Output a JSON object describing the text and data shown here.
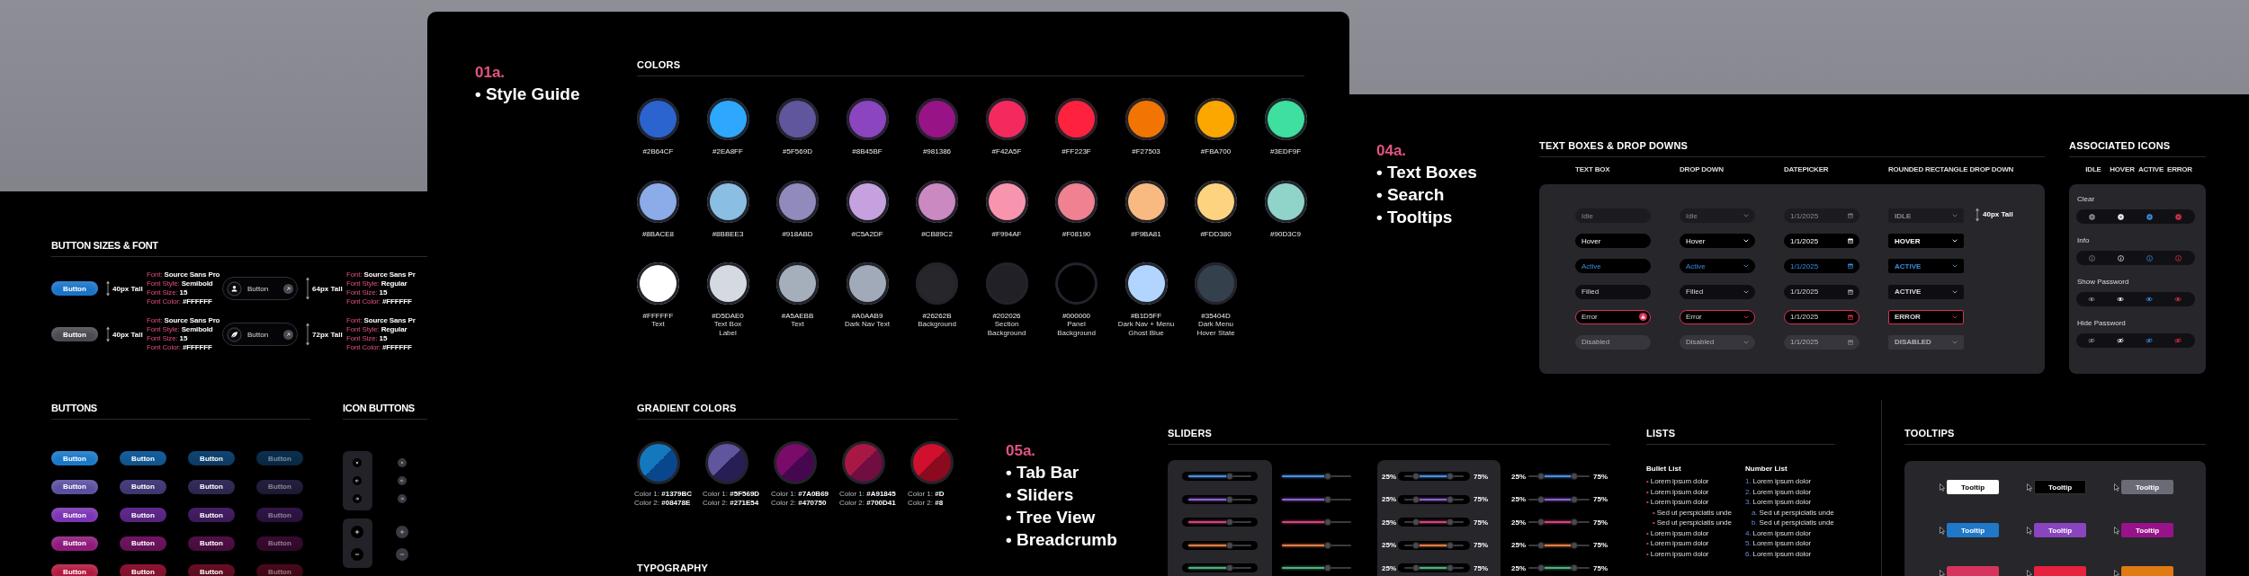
{
  "button_board": {
    "sizes": {
      "title": "BUTTON SIZES & FONT",
      "specs": [
        {
          "kind": "pill",
          "label": "Button",
          "color": "#1a74c8",
          "height": "40px Tall",
          "font": [
            {
              "key": "Font:",
              "value": "Source Sans Pro"
            },
            {
              "key": "Font Style:",
              "value": "Semibold"
            },
            {
              "key": "Font Size:",
              "value": "15"
            },
            {
              "key": "Font Color:",
              "value": "#FFFFFF"
            }
          ]
        },
        {
          "kind": "icon-pill",
          "label": "Button",
          "height": "64px Tall",
          "font": [
            {
              "key": "Font:",
              "value": "Source Sans Pr"
            },
            {
              "key": "Font Style:",
              "value": "Regular"
            },
            {
              "key": "Font Size:",
              "value": "15"
            },
            {
              "key": "Font Color:",
              "value": "#FFFFFF"
            }
          ]
        },
        {
          "kind": "pill",
          "label": "Button",
          "color": "#4a4a50",
          "height": "40px Tall",
          "font": [
            {
              "key": "Font:",
              "value": "Source Sans Pro"
            },
            {
              "key": "Font Style:",
              "value": "Semibold"
            },
            {
              "key": "Font Size:",
              "value": "15"
            },
            {
              "key": "Font Color:",
              "value": "#FFFFFF"
            }
          ]
        },
        {
          "kind": "icon-pill",
          "label": "Button",
          "height": "72px Tall",
          "font": [
            {
              "key": "Font:",
              "value": "Source Sans Pr"
            },
            {
              "key": "Font Style:",
              "value": "Regular"
            },
            {
              "key": "Font Size:",
              "value": "15"
            },
            {
              "key": "Font Color:",
              "value": "#FFFFFF"
            }
          ]
        }
      ]
    },
    "buttons": {
      "title": "BUTTONS",
      "rows": [
        {
          "color": "#1a78c8",
          "buttons": [
            {
              "label": "Button",
              "kind": "normal"
            },
            {
              "label": "Button",
              "kind": "hover"
            },
            {
              "label": "Button",
              "kind": "pressed"
            },
            {
              "label": "Button",
              "kind": "disabled"
            }
          ]
        },
        {
          "color": "#5a4fa0",
          "buttons": [
            {
              "label": "Button",
              "kind": "normal"
            },
            {
              "label": "Button",
              "kind": "hover"
            },
            {
              "label": "Button",
              "kind": "pressed"
            },
            {
              "label": "Button",
              "kind": "disabled"
            }
          ]
        },
        {
          "color": "#7b34b4",
          "buttons": [
            {
              "label": "Button",
              "kind": "normal"
            },
            {
              "label": "Button",
              "kind": "hover"
            },
            {
              "label": "Button",
              "kind": "pressed"
            },
            {
              "label": "Button",
              "kind": "disabled"
            }
          ]
        },
        {
          "color": "#8e1a7c",
          "buttons": [
            {
              "label": "Button",
              "kind": "normal"
            },
            {
              "label": "Button",
              "kind": "hover"
            },
            {
              "label": "Button",
              "kind": "pressed"
            },
            {
              "label": "Button",
              "kind": "disabled"
            }
          ]
        },
        {
          "color": "#b3183f",
          "buttons": [
            {
              "label": "Button",
              "kind": "normal"
            },
            {
              "label": "Button",
              "kind": "hover"
            },
            {
              "label": "Button",
              "kind": "pressed"
            },
            {
              "label": "Button",
              "kind": "disabled"
            }
          ]
        }
      ]
    },
    "icon_buttons": {
      "title": "ICON BUTTONS"
    }
  },
  "style_board": {
    "number": "01a.",
    "topics": [
      "• Style Guide"
    ],
    "colors": {
      "title": "COLORS",
      "swatches": [
        {
          "hex": "#2B64CF",
          "color": "#2b64cf"
        },
        {
          "hex": "#2EA8FF",
          "color": "#2ea8ff"
        },
        {
          "hex": "#5F569D",
          "color": "#5f569d"
        },
        {
          "hex": "#8B45BF",
          "color": "#8b45bf"
        },
        {
          "hex": "#981386",
          "color": "#981386"
        },
        {
          "hex": "#F42A5F",
          "color": "#f42a5f"
        },
        {
          "hex": "#FF223F",
          "color": "#ff223f"
        },
        {
          "hex": "#F27503",
          "color": "#f27503"
        },
        {
          "hex": "#FBA700",
          "color": "#fba700"
        },
        {
          "hex": "#3EDF9F",
          "color": "#3edf9f"
        },
        {
          "hex": "#8BACE8",
          "color": "#8bace8"
        },
        {
          "hex": "#8BBEE3",
          "color": "#8bbee3"
        },
        {
          "hex": "#918ABD",
          "color": "#918abd"
        },
        {
          "hex": "#C5A2DF",
          "color": "#c5a2df"
        },
        {
          "hex": "#CB89C2",
          "color": "#cb89c2"
        },
        {
          "hex": "#F994AF",
          "color": "#f994af"
        },
        {
          "hex": "#F08190",
          "color": "#f08190"
        },
        {
          "hex": "#F9BA81",
          "color": "#f9ba81"
        },
        {
          "hex": "#FDD380",
          "color": "#fdd380"
        },
        {
          "hex": "#90D3C9",
          "color": "#90d3c9"
        },
        {
          "hex": "#FFFFFF",
          "color": "#ffffff",
          "name": "Text"
        },
        {
          "hex": "#D5DAE0",
          "color": "#d5dae0",
          "name": "Text Box\nLabel"
        },
        {
          "hex": "#A5AEBB",
          "color": "#a5aebb",
          "name": "Text"
        },
        {
          "hex": "#A0AAB9",
          "color": "#a0aab9",
          "name": "Dark Nav Text"
        },
        {
          "hex": "#26262B",
          "color": "#26262b",
          "name": "Background"
        },
        {
          "hex": "#202026",
          "color": "#202026",
          "name": "Section\nBackground"
        },
        {
          "hex": "#000000",
          "color": "#000000",
          "name": "Panel\nBackground"
        },
        {
          "hex": "#B1D5FF",
          "color": "#b1d5ff",
          "name": "Dark Nav + Menu\nGhost Blue"
        },
        {
          "hex": "#35404D",
          "color": "#35404d",
          "name": "Dark Menu\nHover State"
        }
      ]
    },
    "gradients": {
      "title": "GRADIENT COLORS",
      "items": [
        {
          "stops": [
            {
              "color": "#1379bc"
            },
            {
              "color": "#08478e"
            }
          ],
          "lines": [
            {
              "key": "Color 1:",
              "value": "#1379BC"
            },
            {
              "key": "Color 2:",
              "value": "#08478E"
            }
          ]
        },
        {
          "stops": [
            {
              "color": "#5f569d"
            },
            {
              "color": "#271e54"
            }
          ],
          "lines": [
            {
              "key": "Color 1:",
              "value": "#5F569D"
            },
            {
              "key": "Color 2:",
              "value": "#271E54"
            }
          ]
        },
        {
          "stops": [
            {
              "color": "#7a0b69"
            },
            {
              "color": "#470750"
            }
          ],
          "lines": [
            {
              "key": "Color 1:",
              "value": "#7A0B69"
            },
            {
              "key": "Color 2:",
              "value": "#470750"
            }
          ]
        },
        {
          "stops": [
            {
              "color": "#a91845"
            },
            {
              "color": "#700d41"
            }
          ],
          "lines": [
            {
              "key": "Color 1:",
              "value": "#A91845"
            },
            {
              "key": "Color 2:",
              "value": "#700D41"
            }
          ]
        },
        {
          "stops": [
            {
              "color": "#d0102c"
            },
            {
              "color": "#8b0a1e"
            }
          ],
          "lines": [
            {
              "key": "Color 1:",
              "value": "#D"
            },
            {
              "key": "Color 2:",
              "value": "#8"
            }
          ]
        }
      ]
    },
    "typography": {
      "title": "TYPOGRAPHY"
    }
  },
  "textbox_board": {
    "number": "04a.",
    "topics": [
      "• Text Boxes",
      "• Search",
      "• Tooltips"
    ],
    "fields": {
      "title": "TEXT BOXES & DROP DOWNS",
      "size_note": "40px Tall",
      "columns": [
        {
          "label": "TEXT BOX",
          "kind": "text"
        },
        {
          "label": "DROP DOWN",
          "kind": "dropdown"
        },
        {
          "label": "DATEPICKER",
          "kind": "date"
        },
        {
          "label": "ROUNDED RECTANGLE DROP DOWN",
          "kind": "rect-dropdown"
        }
      ],
      "rows": [
        {
          "kind": "idle",
          "values": [
            "Idle",
            "Idle",
            "1/1/2025",
            "IDLE"
          ]
        },
        {
          "kind": "hover",
          "values": [
            "Hover",
            "Hover",
            "1/1/2025",
            "HOVER"
          ]
        },
        {
          "kind": "active",
          "values": [
            "Active",
            "Active",
            "1/1/2025",
            "ACTIVE"
          ]
        },
        {
          "kind": "filled",
          "values": [
            "Filled",
            "Filled",
            "1/1/2025",
            "ACTIVE"
          ]
        },
        {
          "kind": "error",
          "values": [
            "Error",
            "Error",
            "1/1/2025",
            "ERROR"
          ]
        },
        {
          "kind": "disabled",
          "values": [
            "Disabled",
            "Disabled",
            "1/1/2025",
            "DISABLED"
          ]
        }
      ]
    },
    "icons": {
      "title": "ASSOCIATED ICONS",
      "columns": [
        {
          "label": "IDLE",
          "kind": "idle"
        },
        {
          "label": "HOVER",
          "kind": "hover"
        },
        {
          "label": "ACTIVE",
          "kind": "active"
        },
        {
          "label": "ERROR",
          "kind": "error"
        }
      ],
      "rows": [
        {
          "label": "Clear",
          "kind": "clear"
        },
        {
          "label": "Info",
          "kind": "info"
        },
        {
          "label": "Show Password",
          "kind": "eye"
        },
        {
          "label": "Hide Password",
          "kind": "eye-off"
        }
      ]
    }
  },
  "components_board": {
    "number": "05a.",
    "topics": [
      "• Tab Bar",
      "• Sliders",
      "• Tree View",
      "• Breadcrumb"
    ],
    "sliders": {
      "title": "SLIDERS",
      "groups": [
        {
          "kind": "single",
          "panel": true,
          "rows": [
            {
              "color": "#4b8fdf",
              "level": 0.65
            },
            {
              "color": "#8d5fd0",
              "level": 0.65
            },
            {
              "color": "#d0457f",
              "level": 0.65
            },
            {
              "color": "#e07d45",
              "level": 0.65
            },
            {
              "color": "#4fb07f",
              "level": 0.65
            }
          ]
        },
        {
          "kind": "single",
          "panel": false,
          "rows": [
            {
              "color": "#4b8fdf",
              "level": 0.66
            },
            {
              "color": "#8d5fd0",
              "level": 0.66
            },
            {
              "color": "#d0457f",
              "level": 0.66
            },
            {
              "color": "#e07d45",
              "level": 0.66
            },
            {
              "color": "#4fb07f",
              "level": 0.66
            }
          ]
        },
        {
          "kind": "range",
          "panel": true,
          "rows": [
            {
              "color": "#4b8fdf",
              "min_label": "25%",
              "max_label": "75%",
              "start": {
                "level": 0.2
              },
              "end": {
                "level": 0.78
              }
            },
            {
              "color": "#8d5fd0",
              "min_label": "25%",
              "max_label": "75%",
              "start": {
                "level": 0.2
              },
              "end": {
                "level": 0.78
              }
            },
            {
              "color": "#d0457f",
              "min_label": "25%",
              "max_label": "75%",
              "start": {
                "level": 0.2
              },
              "end": {
                "level": 0.78
              }
            },
            {
              "color": "#e07d45",
              "min_label": "25%",
              "max_label": "75%",
              "start": {
                "level": 0.2
              },
              "end": {
                "level": 0.78
              }
            },
            {
              "color": "#4fb07f",
              "min_label": "25%",
              "max_label": "75%",
              "start": {
                "level": 0.2
              },
              "end": {
                "level": 0.78
              }
            }
          ]
        },
        {
          "kind": "range",
          "panel": false,
          "rows": [
            {
              "color": "#4b8fdf",
              "min_label": "25%",
              "max_label": "75%",
              "start": {
                "level": 0.2
              },
              "end": {
                "level": 0.75
              }
            },
            {
              "color": "#8d5fd0",
              "min_label": "25%",
              "max_label": "75%",
              "start": {
                "level": 0.2
              },
              "end": {
                "level": 0.75
              }
            },
            {
              "color": "#d0457f",
              "min_label": "25%",
              "max_label": "75%",
              "start": {
                "level": 0.2
              },
              "end": {
                "level": 0.75
              }
            },
            {
              "color": "#e07d45",
              "min_label": "25%",
              "max_label": "75%",
              "start": {
                "level": 0.2
              },
              "end": {
                "level": 0.75
              }
            },
            {
              "color": "#4fb07f",
              "min_label": "25%",
              "max_label": "75%",
              "start": {
                "level": 0.2
              },
              "end": {
                "level": 0.75
              }
            }
          ]
        }
      ]
    },
    "lists": {
      "title": "LISTS",
      "bullet": {
        "title": "Bullet List",
        "items": [
          {
            "marker": "•",
            "text": "Lorem ipsum dolor"
          },
          {
            "marker": "•",
            "text": "Lorem ipsum dolor"
          },
          {
            "marker": "•",
            "text": "Lorem ipsum dolor",
            "children": [
              {
                "marker": "•",
                "text": "Sed ut perspiciatis unde"
              },
              {
                "marker": "•",
                "text": "Sed ut perspiciatis unde"
              }
            ]
          },
          {
            "marker": "•",
            "text": "Lorem ipsum dolor"
          },
          {
            "marker": "•",
            "text": "Lorem ipsum dolor"
          },
          {
            "marker": "•",
            "text": "Lorem ipsum dolor"
          }
        ]
      },
      "numbered": {
        "title": "Number List",
        "items": [
          {
            "marker": "1.",
            "text": "Lorem ipsum dolor"
          },
          {
            "marker": "2.",
            "text": "Lorem ipsum dolor"
          },
          {
            "marker": "3.",
            "text": "Lorem ipsum dolor",
            "children": [
              {
                "marker": "a.",
                "text": "Sed ut perspiciatis unde"
              },
              {
                "marker": "b.",
                "text": "Sed ut perspiciatis unde"
              }
            ]
          },
          {
            "marker": "4.",
            "text": "Lorem ipsum dolor"
          },
          {
            "marker": "5.",
            "text": "Lorem ipsum dolor"
          },
          {
            "marker": "6.",
            "text": "Lorem ipsum dolor"
          }
        ]
      }
    },
    "tooltips": {
      "title": "TOOLTIPS",
      "items": [
        {
          "label": "Tooltip",
          "color": "#ffffff"
        },
        {
          "label": "Tooltip",
          "color": "#000000"
        },
        {
          "label": "Tooltip",
          "color": "#6b6b76"
        },
        {
          "label": "Tooltip",
          "color": "#1f78c8"
        },
        {
          "label": "Tooltip",
          "color": "#8a44c0"
        },
        {
          "label": "Tooltip",
          "color": "#98138a"
        },
        {
          "color": "#d6345c"
        },
        {
          "color": "#e8213e"
        },
        {
          "color": "#e07a12"
        }
      ]
    }
  }
}
